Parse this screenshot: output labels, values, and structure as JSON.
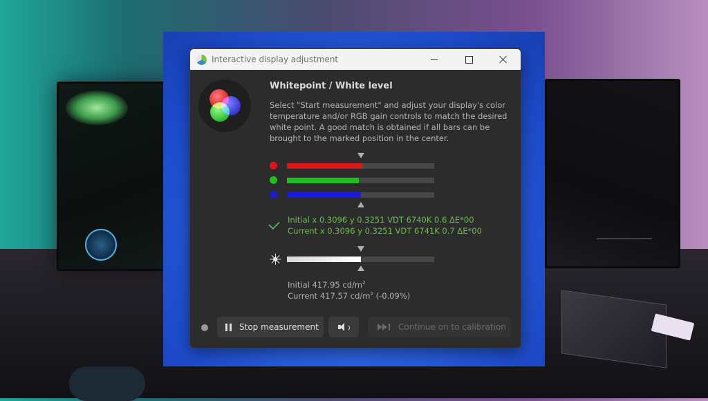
{
  "window": {
    "title": "Interactive display adjustment"
  },
  "panel": {
    "heading": "Whitepoint / White level",
    "instructions": "Select \"Start measurement\" and adjust your display's color temperature and/or RGB gain controls to match the desired white point. A good match is obtained if all bars can be brought to the marked position in the center."
  },
  "rgb_bars": [
    {
      "channel": "red",
      "color": "#e01515",
      "level": 0.51
    },
    {
      "channel": "green",
      "color": "#20c020",
      "level": 0.49
    },
    {
      "channel": "blue",
      "color": "#1a1ad8",
      "level": 0.5
    }
  ],
  "whitepoint": {
    "initial": "Initial x 0.3096 y 0.3251 VDT 6740K 0.6 ΔE*00",
    "current": "Current x 0.3096 y 0.3251 VDT 6741K 0.7 ΔE*00"
  },
  "white_level": {
    "level": 0.5,
    "initial_prefix": "Initial 417.95 cd/m",
    "initial_sup": "2",
    "current_prefix": "Current 417.57 cd/m",
    "current_sup": "2",
    "current_suffix": " (-0.09%)"
  },
  "buttons": {
    "stop": "Stop measurement",
    "continue": "Continue on to calibration"
  },
  "icons": {
    "app": "displaycal-icon",
    "check": "check-icon",
    "brightness": "sun-icon",
    "sound": "speaker-icon",
    "pause": "pause-icon",
    "skip": "skip-forward-icon"
  },
  "colors": {
    "accent_green": "#6cc04a",
    "dialog_bg": "#2c2c2c"
  }
}
